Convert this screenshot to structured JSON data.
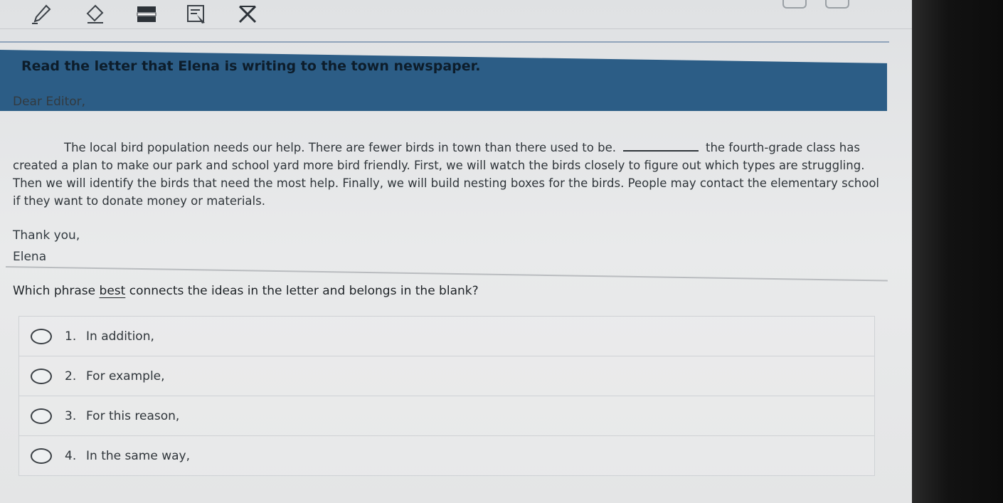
{
  "toolbar": {
    "tools": [
      "pencil-icon",
      "eraser-icon",
      "line-reader-icon",
      "highlighter-icon",
      "answer-eliminator-icon"
    ]
  },
  "prompt": {
    "title": "Read the letter that Elena is writing to the town newspaper."
  },
  "letter": {
    "greeting": "Dear Editor,",
    "line1_before_blank": "The local bird population needs our help. There are fewer birds in town than there used to be.",
    "line1_after_blank": "the fourth-grade class has",
    "line2": "created a plan to make our park and school yard more bird friendly. First, we will watch the birds closely to figure out which types are struggling.",
    "line3": "Then we will identify the birds that need the most help. Finally, we will build nesting boxes for the birds. People may contact the elementary school",
    "line4": "if they want to donate money or materials.",
    "closing": "Thank you,",
    "signature": "Elena"
  },
  "question": {
    "before": "Which phrase ",
    "emphasis": "best",
    "after": " connects the ideas in the letter and belongs in the blank?"
  },
  "options": [
    {
      "number": "1.",
      "text": "In addition,"
    },
    {
      "number": "2.",
      "text": "For example,"
    },
    {
      "number": "3.",
      "text": "For this reason,"
    },
    {
      "number": "4.",
      "text": "In the same way,"
    }
  ]
}
